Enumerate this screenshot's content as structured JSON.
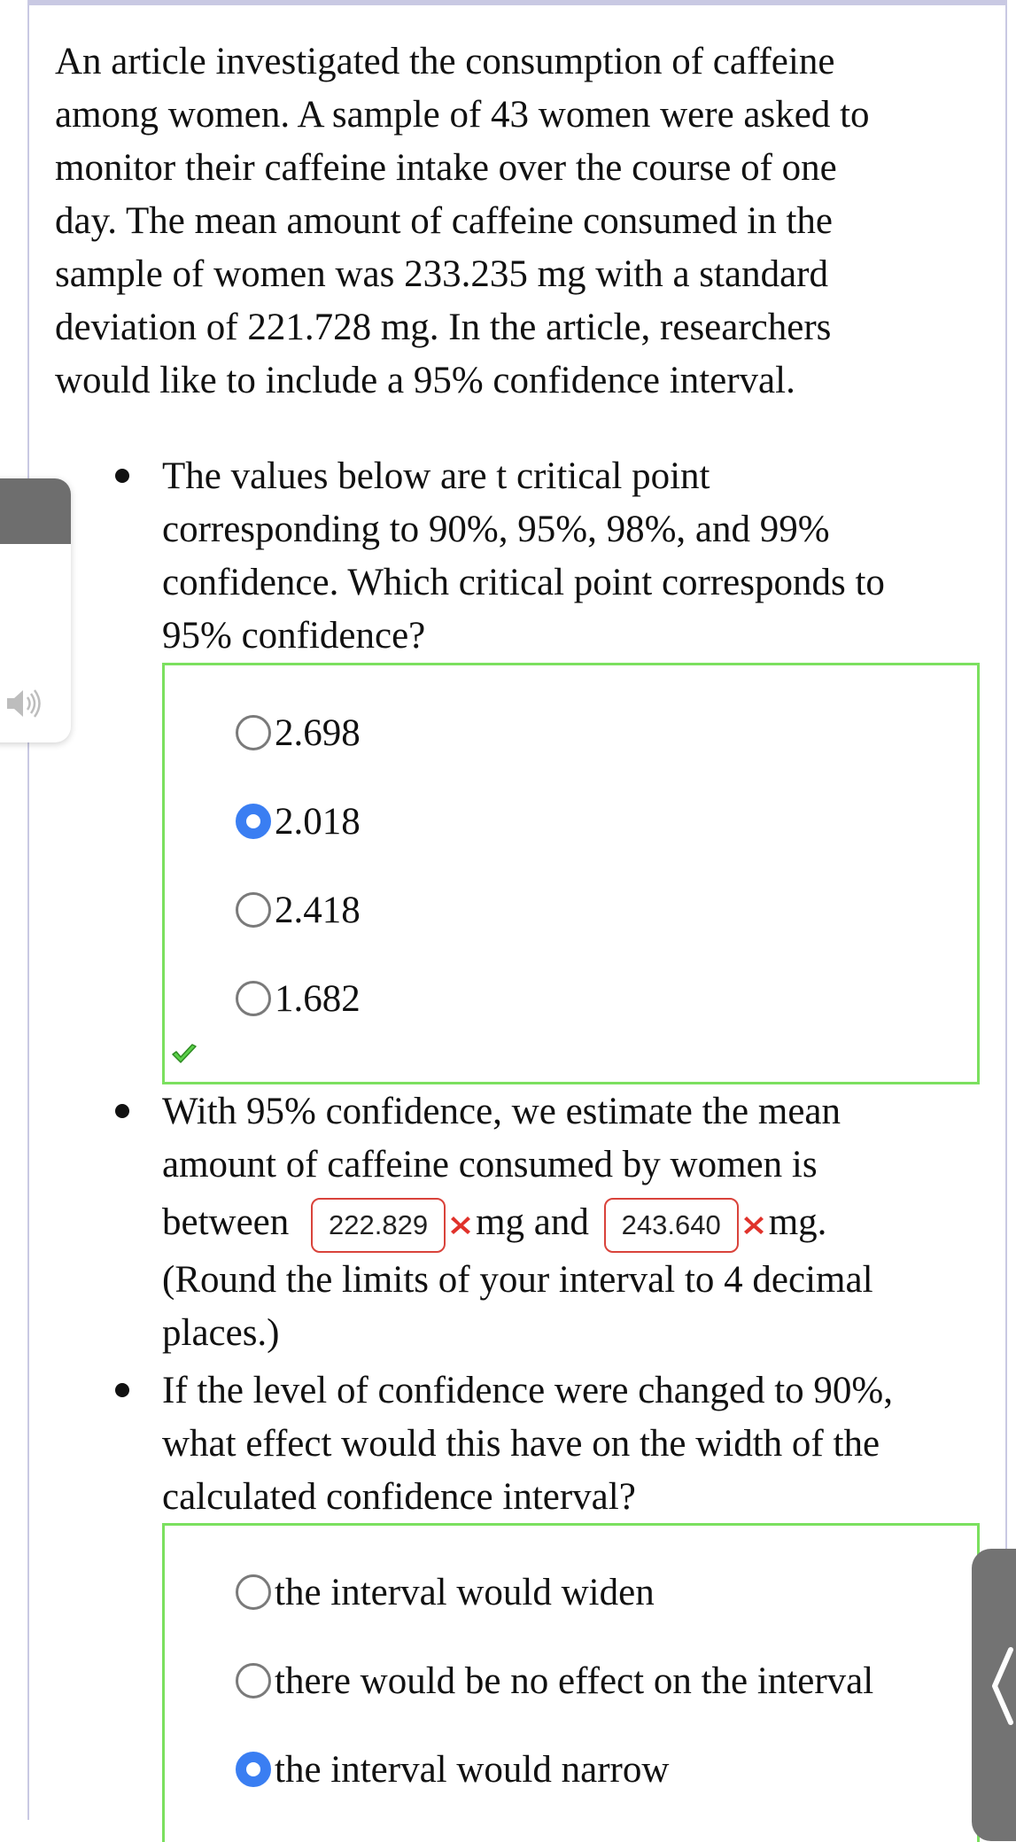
{
  "intro": {
    "line1": "An article investigated the consumption of caffeine",
    "line2": "among women. A sample of 43 women were asked to",
    "line3": "monitor their caffeine intake over the course of one",
    "line4": "day. The mean amount of caffeine consumed in the",
    "line5": "sample of women was 233.235 mg with a standard",
    "line6": "deviation of 221.728 mg. In the article, researchers",
    "line7": "would like to include a 95% confidence interval."
  },
  "q1": {
    "line1": "The values below are t critical point",
    "line2": "corresponding to 90%, 95%, 98%, and 99%",
    "line3": "confidence. Which critical point corresponds to",
    "line4": "95% confidence?",
    "options": [
      "2.698",
      "2.018",
      "2.418",
      "1.682"
    ],
    "selected_index": 1,
    "status": "correct"
  },
  "q2": {
    "line1": "With 95% confidence, we estimate the mean",
    "line2": "amount of caffeine consumed by women is",
    "between": "between",
    "lower_value": "222.829",
    "mg_and": "mg and",
    "upper_value": "243.640",
    "mg_end": "mg.",
    "line4": "(Round the limits of your interval to 4 decimal",
    "line5": "places.)",
    "status_lower": "incorrect",
    "status_upper": "incorrect"
  },
  "q3": {
    "line1": "If the level of confidence were changed to 90%,",
    "line2": "what effect would this have on the width of the",
    "line3": "calculated confidence interval?",
    "options": [
      "the interval would widen",
      "there would be no effect on the interval",
      "the interval would narrow"
    ],
    "selected_index": 2
  },
  "colors": {
    "correct_border": "#7be05f",
    "incorrect_border": "#d9433b",
    "radio_selected": "#3a7ef2",
    "card_border": "#c9c9e3",
    "side_tab": "#737373"
  },
  "icons": {
    "speaker": "speaker-icon",
    "check": "check-icon",
    "incorrect": "x-icon",
    "collapse": "chevron-left-icon"
  }
}
